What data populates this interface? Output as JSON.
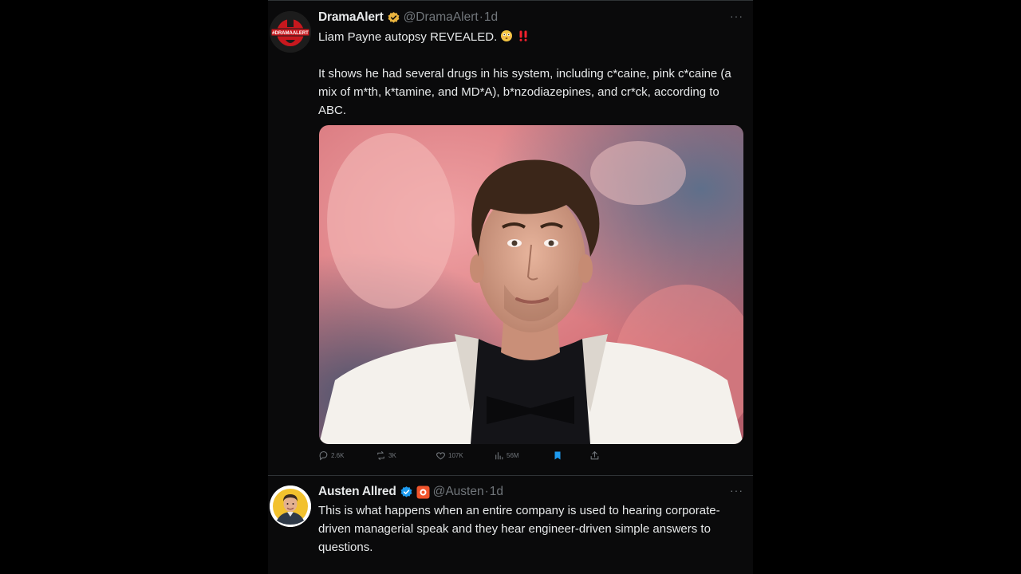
{
  "post1": {
    "display_name": "DramaAlert",
    "handle": "@DramaAlert",
    "separator": "·",
    "time": "1d",
    "more": "···",
    "avatar_text": "#DRAMAALERT",
    "line1": "Liam Payne autopsy REVEALED.",
    "paragraph": "It shows he had several drugs in his system, including c*caine, pink c*caine (a mix of m*th, k*tamine, and MD*A), b*nzodiazepines, and cr*ck, according to ABC.",
    "actions": {
      "replies": "2.6K",
      "reposts": "3K",
      "likes": "107K",
      "views": "56M"
    },
    "colors": {
      "verified": "#e9b33e",
      "bookmark": "#1d9bf0",
      "alert": "#f4212e"
    }
  },
  "post2": {
    "display_name": "Austen Allred",
    "handle": "@Austen",
    "separator": "·",
    "time": "1d",
    "more": "···",
    "paragraph": "This is what happens when an entire company is used to hearing corporate-driven managerial speak and they hear engineer-driven simple answers to questions.",
    "colors": {
      "verified": "#1d9bf0",
      "affiliate": "#f0542c"
    }
  }
}
